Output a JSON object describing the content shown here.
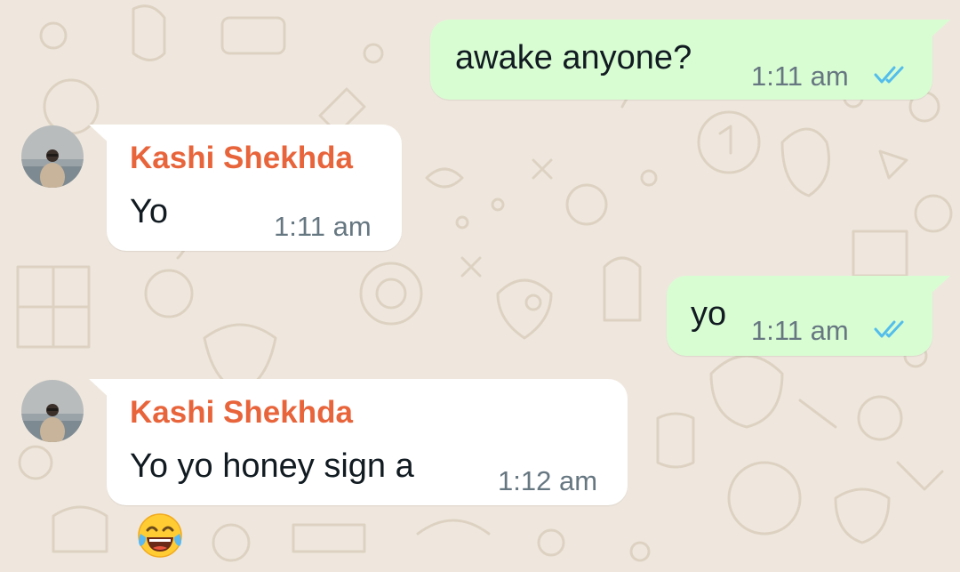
{
  "colors": {
    "wallpaper": "#efe7dd",
    "outgoing_bubble": "#d9fdd3",
    "incoming_bubble": "#ffffff",
    "sender_name": "#e8643b",
    "read_ticks": "#53bdeb",
    "timestamp": "#667781"
  },
  "messages": [
    {
      "direction": "outgoing",
      "text": "awake anyone?",
      "time": "1:11 am",
      "status_icon": "double-check-read-icon"
    },
    {
      "direction": "incoming",
      "sender": "Kashi Shekhda",
      "text": "Yo",
      "time": "1:11 am",
      "avatar_icon": "contact-avatar"
    },
    {
      "direction": "outgoing",
      "text": "yo",
      "time": "1:11 am",
      "status_icon": "double-check-read-icon"
    },
    {
      "direction": "incoming",
      "sender": "Kashi Shekhda",
      "text": "Yo yo honey sign a",
      "time": "1:12 am",
      "avatar_icon": "contact-avatar",
      "reaction_icon": "face-with-tears-of-joy-emoji"
    }
  ]
}
